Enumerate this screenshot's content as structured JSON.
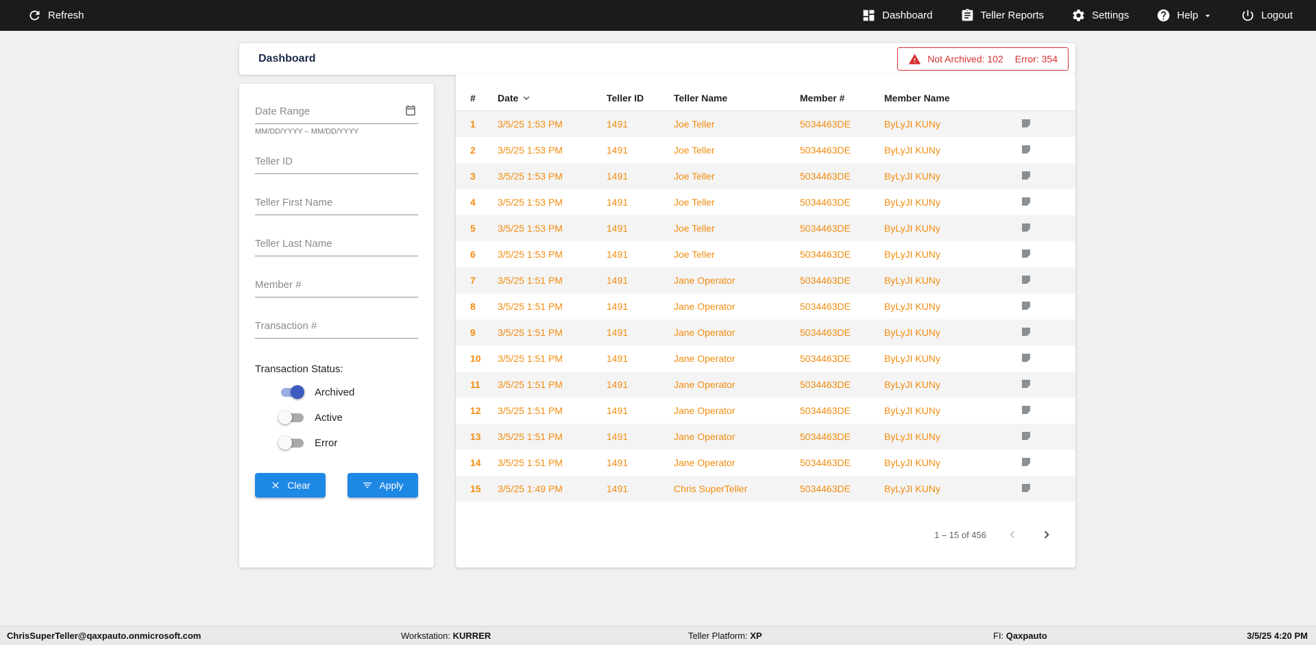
{
  "colors": {
    "orange": "#F28C0F",
    "red": "#D32F2F",
    "blue": "#1E88E5",
    "toggleOnKnob": "#3C5BC0",
    "toggleOnTrack": "#9AAEE3"
  },
  "topbar": {
    "refresh": "Refresh",
    "nav": [
      {
        "label": "Dashboard"
      },
      {
        "label": "Teller Reports"
      },
      {
        "label": "Settings"
      },
      {
        "label": "Help"
      },
      {
        "label": "Logout"
      }
    ]
  },
  "header": {
    "title": "Dashboard",
    "alert": {
      "not_archived": "Not Archived: 102",
      "error": "Error: 354"
    }
  },
  "filters": {
    "date_range": {
      "placeholder": "Date Range",
      "helper": "MM/DD/YYYY – MM/DD/YYYY"
    },
    "teller_id": {
      "placeholder": "Teller ID"
    },
    "teller_first_name": {
      "placeholder": "Teller First Name"
    },
    "teller_last_name": {
      "placeholder": "Teller Last Name"
    },
    "member_number": {
      "placeholder": "Member #"
    },
    "transaction_number": {
      "placeholder": "Transaction #"
    },
    "status": {
      "label": "Transaction Status:",
      "toggles": [
        {
          "label": "Archived",
          "on": true
        },
        {
          "label": "Active",
          "on": false
        },
        {
          "label": "Error",
          "on": false
        }
      ]
    },
    "clear_button": "Clear",
    "apply_button": "Apply"
  },
  "table": {
    "columns": [
      "#",
      "Date",
      "Teller ID",
      "Teller Name",
      "Member #",
      "Member Name"
    ],
    "sort_column": "Date",
    "rows": [
      {
        "num": "1",
        "date": "3/5/25 1:53 PM",
        "teller_id": "1491",
        "teller_name": "Joe Teller",
        "member_number": "5034463DE",
        "member_name": "ByLyJI KUNy"
      },
      {
        "num": "2",
        "date": "3/5/25 1:53 PM",
        "teller_id": "1491",
        "teller_name": "Joe Teller",
        "member_number": "5034463DE",
        "member_name": "ByLyJI KUNy"
      },
      {
        "num": "3",
        "date": "3/5/25 1:53 PM",
        "teller_id": "1491",
        "teller_name": "Joe Teller",
        "member_number": "5034463DE",
        "member_name": "ByLyJI KUNy"
      },
      {
        "num": "4",
        "date": "3/5/25 1:53 PM",
        "teller_id": "1491",
        "teller_name": "Joe Teller",
        "member_number": "5034463DE",
        "member_name": "ByLyJI KUNy"
      },
      {
        "num": "5",
        "date": "3/5/25 1:53 PM",
        "teller_id": "1491",
        "teller_name": "Joe Teller",
        "member_number": "5034463DE",
        "member_name": "ByLyJI KUNy"
      },
      {
        "num": "6",
        "date": "3/5/25 1:53 PM",
        "teller_id": "1491",
        "teller_name": "Joe Teller",
        "member_number": "5034463DE",
        "member_name": "ByLyJI KUNy"
      },
      {
        "num": "7",
        "date": "3/5/25 1:51 PM",
        "teller_id": "1491",
        "teller_name": "Jane Operator",
        "member_number": "5034463DE",
        "member_name": "ByLyJI KUNy"
      },
      {
        "num": "8",
        "date": "3/5/25 1:51 PM",
        "teller_id": "1491",
        "teller_name": "Jane Operator",
        "member_number": "5034463DE",
        "member_name": "ByLyJI KUNy"
      },
      {
        "num": "9",
        "date": "3/5/25 1:51 PM",
        "teller_id": "1491",
        "teller_name": "Jane Operator",
        "member_number": "5034463DE",
        "member_name": "ByLyJI KUNy"
      },
      {
        "num": "10",
        "date": "3/5/25 1:51 PM",
        "teller_id": "1491",
        "teller_name": "Jane Operator",
        "member_number": "5034463DE",
        "member_name": "ByLyJI KUNy"
      },
      {
        "num": "11",
        "date": "3/5/25 1:51 PM",
        "teller_id": "1491",
        "teller_name": "Jane Operator",
        "member_number": "5034463DE",
        "member_name": "ByLyJI KUNy"
      },
      {
        "num": "12",
        "date": "3/5/25 1:51 PM",
        "teller_id": "1491",
        "teller_name": "Jane Operator",
        "member_number": "5034463DE",
        "member_name": "ByLyJI KUNy"
      },
      {
        "num": "13",
        "date": "3/5/25 1:51 PM",
        "teller_id": "1491",
        "teller_name": "Jane Operator",
        "member_number": "5034463DE",
        "member_name": "ByLyJI KUNy"
      },
      {
        "num": "14",
        "date": "3/5/25 1:51 PM",
        "teller_id": "1491",
        "teller_name": "Jane Operator",
        "member_number": "5034463DE",
        "member_name": "ByLyJI KUNy"
      },
      {
        "num": "15",
        "date": "3/5/25 1:49 PM",
        "teller_id": "1491",
        "teller_name": "Chris SuperTeller",
        "member_number": "5034463DE",
        "member_name": "ByLyJI KUNy"
      }
    ],
    "pagination": {
      "range": "1 – 15 of 456"
    }
  },
  "footer": {
    "user": "ChrisSuperTeller@qaxpauto.onmicrosoft.com",
    "workstation_label": "Workstation:",
    "workstation": "KURRER",
    "platform_label": "Teller Platform:",
    "platform": "XP",
    "fi_label": "FI:",
    "fi": "Qaxpauto",
    "datetime": "3/5/25 4:20 PM"
  }
}
